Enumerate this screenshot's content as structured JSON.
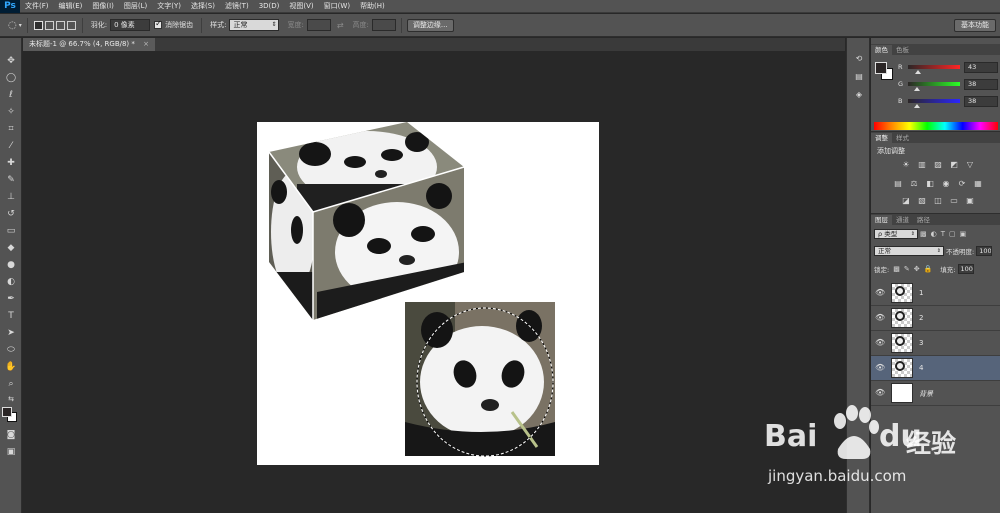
{
  "app": {
    "logo": "Ps"
  },
  "menu": [
    "文件(F)",
    "编辑(E)",
    "图像(I)",
    "图层(L)",
    "文字(Y)",
    "选择(S)",
    "滤镜(T)",
    "3D(D)",
    "视图(V)",
    "窗口(W)",
    "帮助(H)"
  ],
  "options": {
    "feather_label": "羽化:",
    "feather_value": "0 像素",
    "antialias_label": "消除锯齿",
    "style_label": "样式:",
    "style_value": "正常",
    "width_label": "宽度:",
    "height_label": "高度:",
    "refine_edge_button": "调整边缘...",
    "workspace_button": "基本功能"
  },
  "document": {
    "tab_title": "未标题-1 @ 66.7% (4, RGB/8) *",
    "close_glyph": "×"
  },
  "color_panel": {
    "tabs": [
      "颜色",
      "色板"
    ],
    "channels": [
      {
        "label": "R",
        "value": "43",
        "color": "#e02020"
      },
      {
        "label": "G",
        "value": "38",
        "color": "#20b020"
      },
      {
        "label": "B",
        "value": "38",
        "color": "#2040e0"
      }
    ],
    "foreground": "#2b2626",
    "background": "#ffffff"
  },
  "adjust_panel": {
    "tabs": [
      "调整",
      "样式"
    ],
    "title": "添加调整"
  },
  "layers_panel": {
    "tabs": [
      "图层",
      "通道",
      "路径"
    ],
    "filter_label": "ρ 类型",
    "blend_mode": "正常",
    "opacity_label": "不透明度:",
    "opacity_value": "100",
    "lock_label": "锁定:",
    "fill_label": "填充:",
    "fill_value": "100",
    "layers": [
      {
        "name": "1",
        "selected": false
      },
      {
        "name": "2",
        "selected": false
      },
      {
        "name": "3",
        "selected": false
      },
      {
        "name": "4",
        "selected": true
      },
      {
        "name": "背景",
        "selected": false
      }
    ]
  },
  "watermark": {
    "brand_left": "Bai",
    "brand_right": "du",
    "brand_cn": "经验",
    "url": "jingyan.baidu.com"
  },
  "icons": {
    "eye": "eye-icon",
    "close": "close-icon"
  }
}
